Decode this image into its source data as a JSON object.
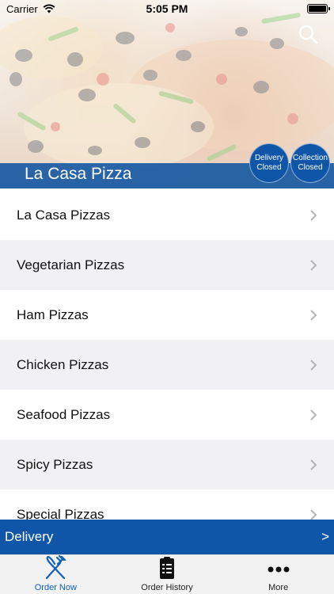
{
  "status_bar": {
    "carrier": "Carrier",
    "time": "5:05 PM"
  },
  "hero": {
    "title": "La Casa Pizza",
    "delivery_status": {
      "line1": "Delivery",
      "line2": "Closed"
    },
    "collection_status": {
      "line1": "Collection",
      "line2": "Closed"
    }
  },
  "menu": {
    "items": [
      {
        "label": "La Casa Pizzas"
      },
      {
        "label": "Vegetarian Pizzas"
      },
      {
        "label": "Ham Pizzas"
      },
      {
        "label": "Chicken Pizzas"
      },
      {
        "label": "Seafood Pizzas"
      },
      {
        "label": "Spicy Pizzas"
      },
      {
        "label": "Special Pizzas"
      }
    ]
  },
  "delivery_bar": {
    "label": "Delivery",
    "arrow": ">"
  },
  "tabs": [
    {
      "label": "Order Now",
      "icon": "fork-knife-icon",
      "active": true
    },
    {
      "label": "Order History",
      "icon": "clipboard-icon",
      "active": false
    },
    {
      "label": "More",
      "icon": "more-dots-icon",
      "active": false
    }
  ],
  "colors": {
    "accent": "#0f56a8",
    "active_tab": "#1060b8"
  }
}
